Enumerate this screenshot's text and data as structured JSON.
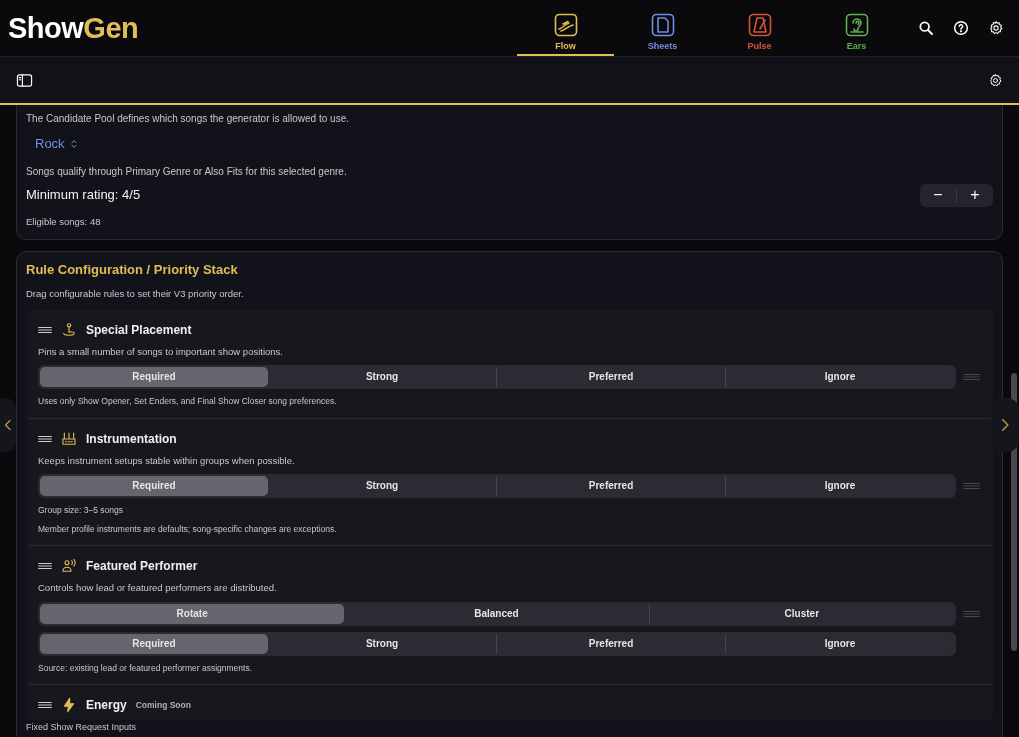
{
  "app": {
    "logo": [
      "Show",
      "Gen"
    ]
  },
  "tabs": [
    {
      "label": "Flow",
      "color": "#e2bd57",
      "selected": true
    },
    {
      "label": "Sheets",
      "color": "#6f8ee6",
      "selected": false
    },
    {
      "label": "Pulse",
      "color": "#d6533a",
      "selected": false
    },
    {
      "label": "Ears",
      "color": "#5fae4f",
      "selected": false
    }
  ],
  "candidate_pool": {
    "description": "The Candidate Pool defines which songs the generator is allowed to use.",
    "genre": "Rock",
    "genre_note": "Songs qualify through Primary Genre or Also Fits for this selected genre.",
    "min_rating": "Minimum rating: 4/5",
    "stepper": [
      "−",
      "+"
    ],
    "eligible": "Eligible songs: 48"
  },
  "rules_section": {
    "title": "Rule Configuration / Priority Stack",
    "subtitle": "Drag configurable rules to set their V3 priority order.",
    "rules": [
      {
        "title": "Special Placement",
        "description": "Pins a small number of songs to important show positions.",
        "controls": [
          {
            "options": [
              {
                "label": "Required",
                "selected": true
              },
              {
                "label": "Strong",
                "selected": false
              },
              {
                "label": "Preferred",
                "selected": false
              },
              {
                "label": "Ignore",
                "selected": false
              }
            ]
          }
        ],
        "notes": [
          "Uses only Show Opener, Set Enders, and Final Show Closer song preferences."
        ]
      },
      {
        "title": "Instrumentation",
        "description": "Keeps instrument setups stable within groups when possible.",
        "controls": [
          {
            "options": [
              {
                "label": "Required",
                "selected": true
              },
              {
                "label": "Strong",
                "selected": false
              },
              {
                "label": "Preferred",
                "selected": false
              },
              {
                "label": "Ignore",
                "selected": false
              }
            ]
          }
        ],
        "notes": [
          "Group size: 3–5 songs",
          "Member profile instruments are defaults; song-specific changes are exceptions."
        ]
      },
      {
        "title": "Featured Performer",
        "description": "Controls how lead or featured performers are distributed.",
        "controls": [
          {
            "options": [
              {
                "label": "Rotate",
                "selected": true
              },
              {
                "label": "Balanced",
                "selected": false
              },
              {
                "label": "Cluster",
                "selected": false
              }
            ]
          },
          {
            "options": [
              {
                "label": "Required",
                "selected": true
              },
              {
                "label": "Strong",
                "selected": false
              },
              {
                "label": "Preferred",
                "selected": false
              },
              {
                "label": "Ignore",
                "selected": false
              }
            ]
          }
        ],
        "notes": [
          "Source: existing lead or featured performer assignments."
        ]
      },
      {
        "title": "Energy",
        "badge": "Coming Soon"
      }
    ],
    "next_section": "Fixed Show Request Inputs"
  }
}
